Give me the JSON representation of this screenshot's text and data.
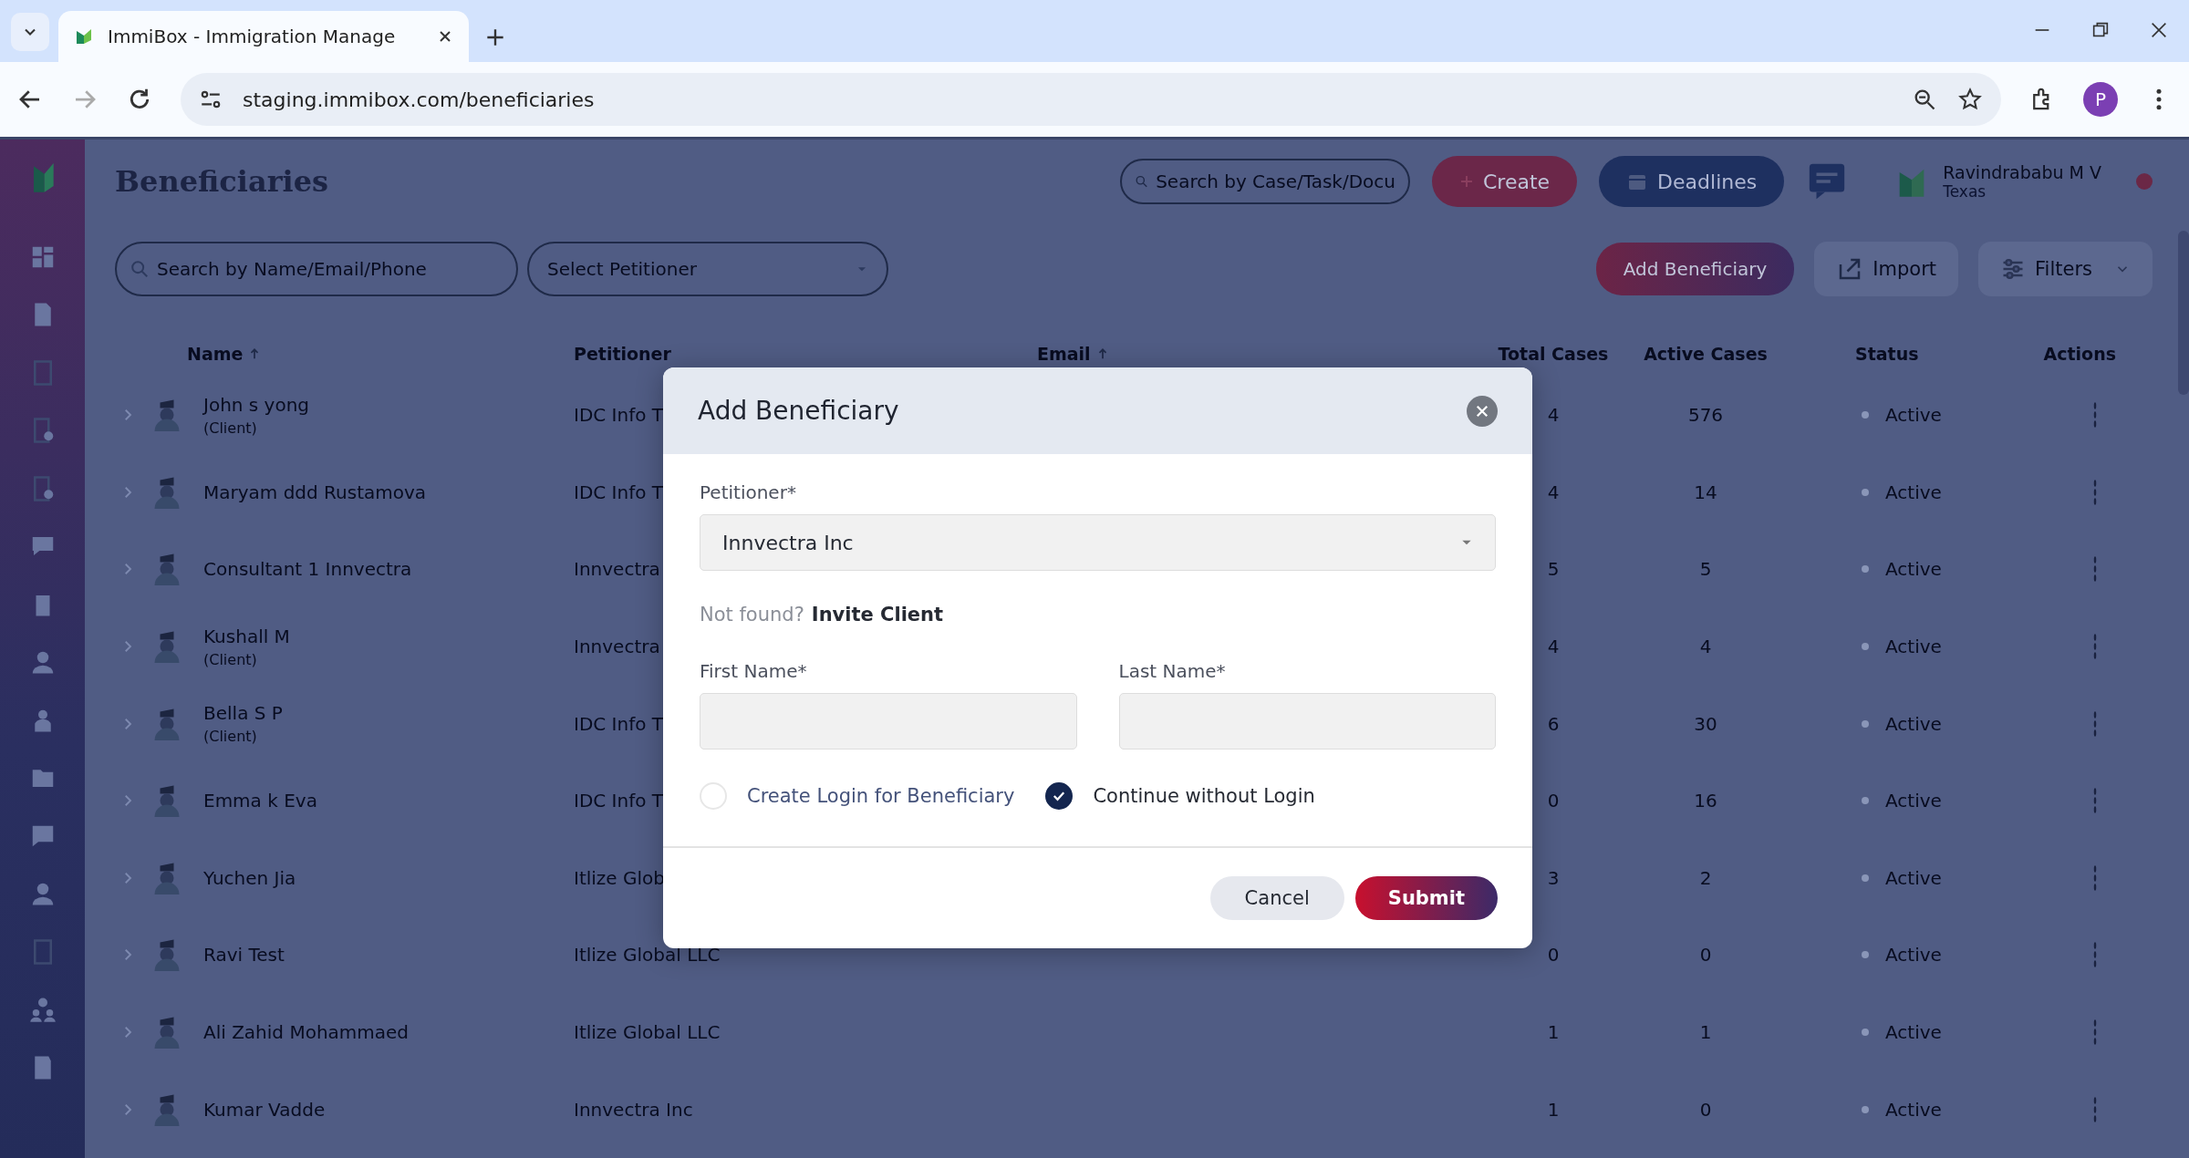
{
  "browser": {
    "tab_title": "ImmiBox - Immigration Manage",
    "url": "staging.immibox.com/beneficiaries",
    "profile": "P"
  },
  "header": {
    "title": "Beneficiaries",
    "search": {
      "placeholder": "Search by Case/Task/Docu"
    },
    "create_button": "Create",
    "deadlines_button": "Deadlines",
    "user": {
      "name": "Ravindrababu M V",
      "location": "Texas"
    }
  },
  "toolbar": {
    "search": {
      "placeholder": "Search by Name/Email/Phone"
    },
    "petitioner_select": {
      "placeholder": "Select Petitioner"
    },
    "add_button": "Add Beneficiary",
    "import_button": "Import",
    "filters_button": "Filters"
  },
  "table": {
    "columns": [
      {
        "label": "Name",
        "sorted": true
      },
      {
        "label": "Petitioner",
        "sorted": false
      },
      {
        "label": "Email",
        "sorted": true
      },
      {
        "label": "Total Cases",
        "sorted": false
      },
      {
        "label": "Active Cases",
        "sorted": false
      },
      {
        "label": "Status",
        "sorted": false
      },
      {
        "label": "Actions",
        "sorted": false
      }
    ],
    "rows": [
      {
        "name": "John s yong",
        "tag": "(Client)",
        "petitioner": "IDC Info T",
        "total_cases": "4",
        "active_cases": "576",
        "status": "Active"
      },
      {
        "name": "Maryam ddd Rustamova",
        "petitioner": "IDC Info T",
        "total_cases": "4",
        "active_cases": "14",
        "status": "Active"
      },
      {
        "name": "Consultant 1 Innvectra",
        "petitioner": "Innvectra",
        "total_cases": "5",
        "active_cases": "5",
        "status": "Active"
      },
      {
        "name": "Kushall M",
        "tag": "(Client)",
        "petitioner": "Innvectra",
        "total_cases": "4",
        "active_cases": "4",
        "status": "Active"
      },
      {
        "name": "Bella S P",
        "tag": "(Client)",
        "petitioner": "IDC Info T",
        "total_cases": "6",
        "active_cases": "30",
        "status": "Active"
      },
      {
        "name": "Emma k Eva",
        "petitioner": "IDC Info T",
        "total_cases": "0",
        "active_cases": "16",
        "status": "Active"
      },
      {
        "name": "Yuchen Jia",
        "petitioner": "Itlize Glob",
        "total_cases": "3",
        "active_cases": "2",
        "status": "Active"
      },
      {
        "name": "Ravi Test",
        "petitioner": "Itlize Global LLC",
        "total_cases": "0",
        "active_cases": "0",
        "status": "Active"
      },
      {
        "name": "Ali Zahid Mohammaed",
        "petitioner": "Itlize Global LLC",
        "total_cases": "1",
        "active_cases": "1",
        "status": "Active"
      },
      {
        "name": "Kumar Vadde",
        "petitioner": "Innvectra Inc",
        "total_cases": "1",
        "active_cases": "0",
        "status": "Active"
      }
    ]
  },
  "dialog": {
    "title": "Add Beneficiary",
    "petitioner": {
      "label": "Petitioner*",
      "value": "Innvectra Inc"
    },
    "not_found": "Not found?",
    "invite_link": "Invite Client",
    "first_name": {
      "label": "First Name*"
    },
    "last_name": {
      "label": "Last Name*"
    },
    "options": [
      {
        "label": "Create Login for Beneficiary",
        "selected": false
      },
      {
        "label": "Continue without Login",
        "selected": true
      }
    ],
    "cancel_button": "Cancel",
    "submit_button": "Submit"
  }
}
